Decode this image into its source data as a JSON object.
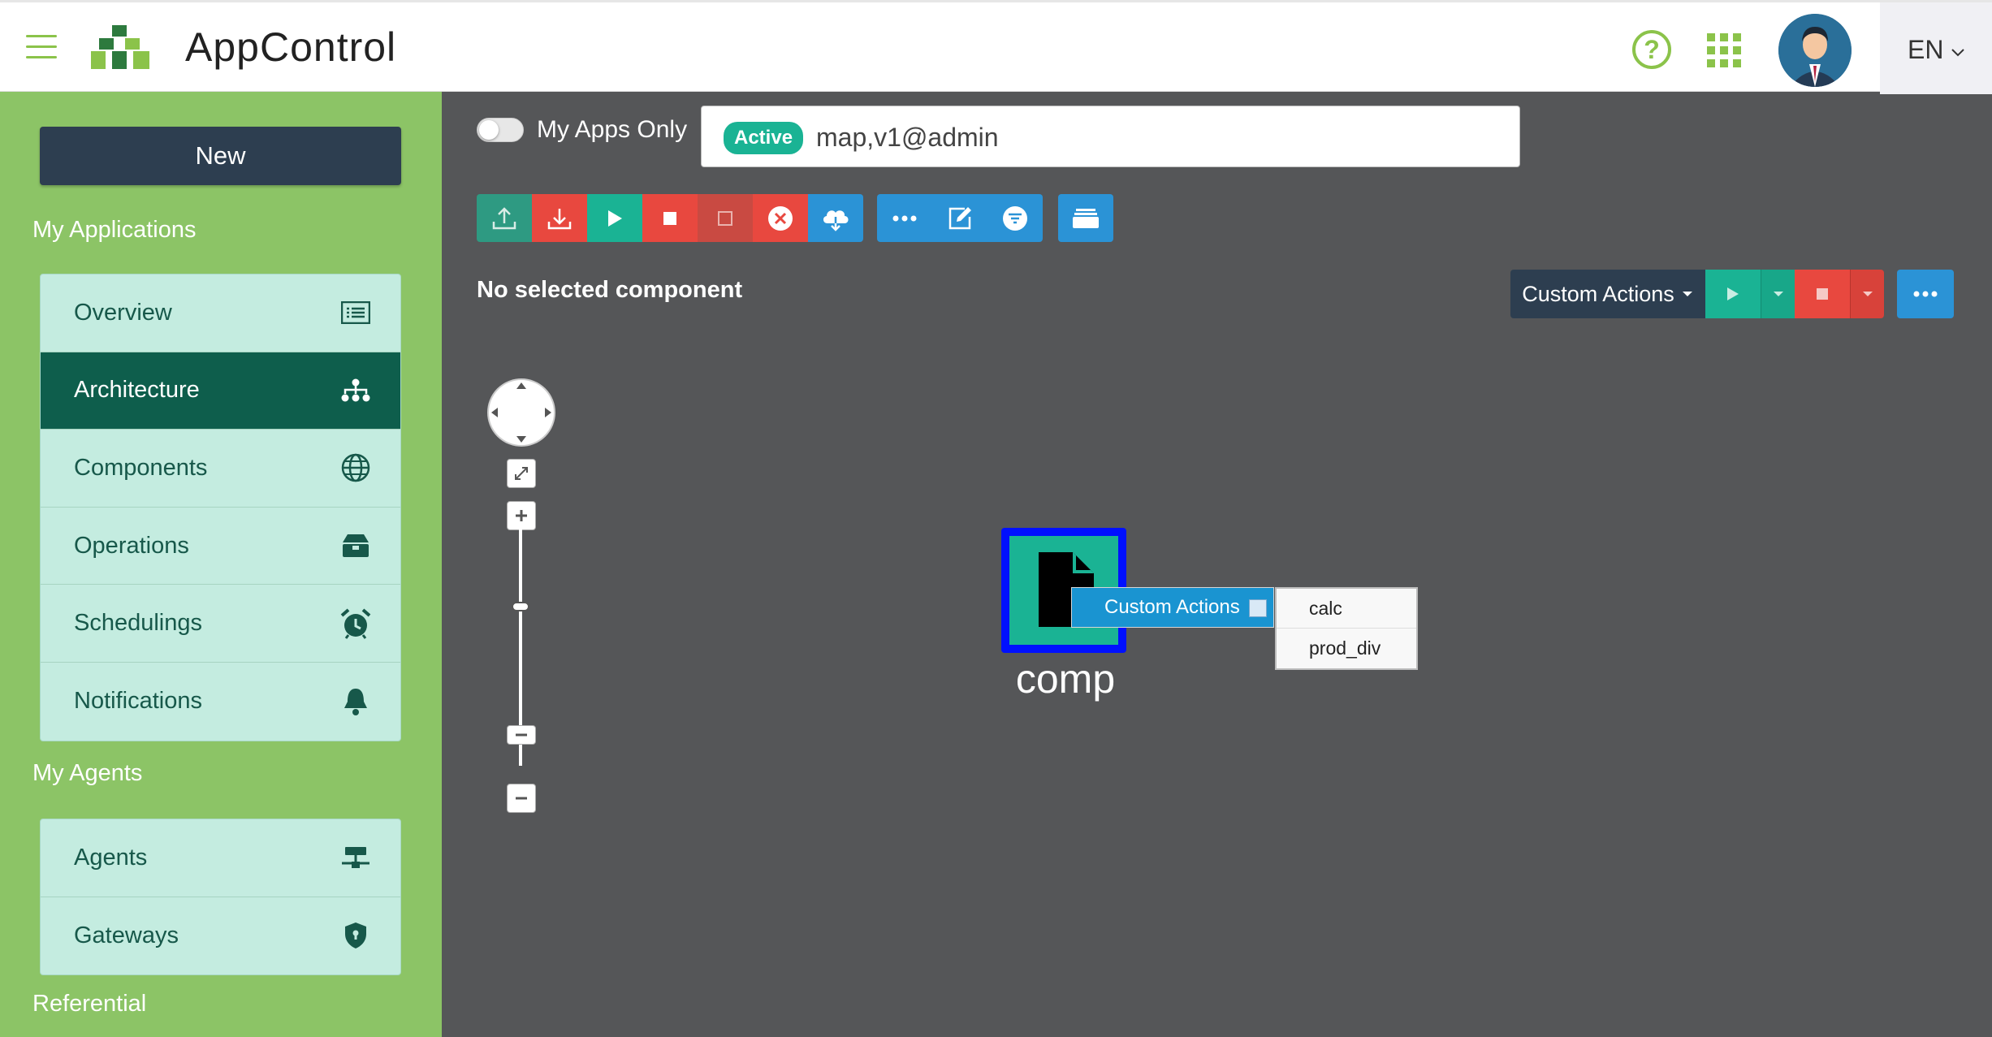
{
  "header": {
    "app_title": "AppControl",
    "language": "EN",
    "icons": {
      "menu": "hamburger-icon",
      "logo": "appcontrol-logo",
      "help": "help-icon",
      "apps": "apps-grid-icon",
      "avatar": "user-avatar"
    },
    "brand_color": "#8bc34a"
  },
  "sidebar": {
    "new_label": "New",
    "my_applications_title": "My Applications",
    "app_items": [
      {
        "label": "Overview",
        "icon": "list-icon",
        "active": false
      },
      {
        "label": "Architecture",
        "icon": "sitemap-icon",
        "active": true
      },
      {
        "label": "Components",
        "icon": "globe-icon",
        "active": false
      },
      {
        "label": "Operations",
        "icon": "toolbox-icon",
        "active": false
      },
      {
        "label": "Schedulings",
        "icon": "alarm-clock-icon",
        "active": false
      },
      {
        "label": "Notifications",
        "icon": "bell-icon",
        "active": false
      }
    ],
    "my_agents_title": "My Agents",
    "agent_items": [
      {
        "label": "Agents",
        "icon": "network-icon"
      },
      {
        "label": "Gateways",
        "icon": "shield-icon"
      }
    ],
    "referential_title": "Referential"
  },
  "main": {
    "my_apps_only_label": "My Apps Only",
    "my_apps_only_enabled": false,
    "app_select": {
      "status": "Active",
      "name": "map,v1@admin"
    },
    "toolbar": [
      {
        "icon": "upload-icon",
        "color": "#2e9a82"
      },
      {
        "icon": "download-icon",
        "color": "#e8483f"
      },
      {
        "icon": "play-icon",
        "color": "#1ab394"
      },
      {
        "icon": "stop-icon",
        "color": "#e8483f"
      },
      {
        "icon": "square-outline-icon",
        "color": "#c94a42"
      },
      {
        "icon": "cancel-icon",
        "color": "#e8483f"
      },
      {
        "icon": "cloud-download-icon",
        "color": "#2b93d6"
      },
      {
        "icon": "more-icon",
        "color": "#2b93d6"
      },
      {
        "icon": "edit-icon",
        "color": "#2b93d6"
      },
      {
        "icon": "filter-icon",
        "color": "#2b93d6"
      },
      {
        "icon": "folder-icon",
        "color": "#2b93d6"
      }
    ],
    "selection_text": "No selected component",
    "custom_actions_label": "Custom Actions",
    "node": {
      "label": "comp",
      "icon": "file-icon",
      "border_color": "#0010ff",
      "fill_color": "#1ab394"
    },
    "context_menu": {
      "label": "Custom Actions",
      "items": [
        "calc",
        "prod_div"
      ]
    }
  }
}
